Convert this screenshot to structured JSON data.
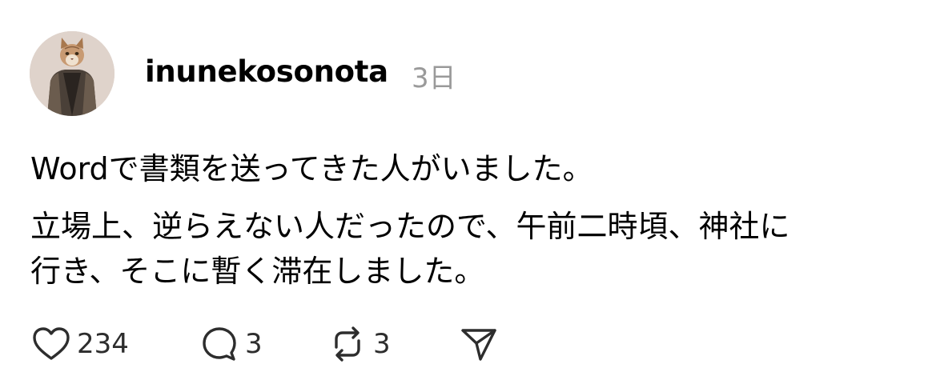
{
  "post": {
    "username": "inunekosonota",
    "timestamp": "3日",
    "body_lines": [
      "Wordで書類を送ってきた人がいました。",
      "立場上、逆らえない人だったので、午前二時頃、神社に",
      "行き、そこに暫く滞在しました。"
    ]
  },
  "actions": {
    "like": {
      "icon": "heart-icon",
      "count": "234"
    },
    "comment": {
      "icon": "comment-bubble-icon",
      "count": "3"
    },
    "repost": {
      "icon": "repost-icon",
      "count": "3"
    },
    "share": {
      "icon": "send-icon"
    }
  },
  "colors": {
    "text": "#000000",
    "muted": "#9a9a9a",
    "icon": "#2d2d2d"
  }
}
